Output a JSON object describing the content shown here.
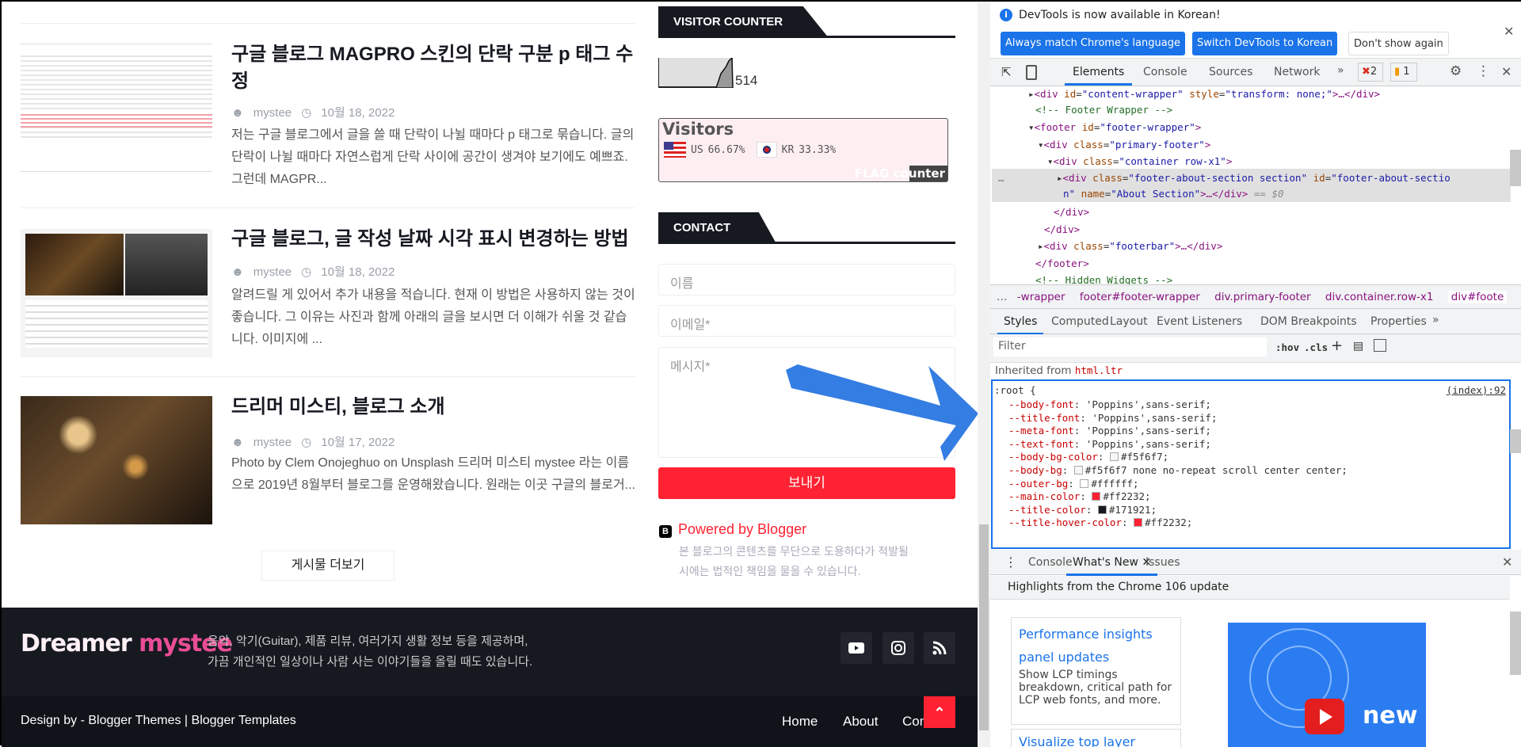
{
  "posts": [
    {
      "title": "구글 블로그 MAGPRO 스킨의 단락 구분 p 태그 수정",
      "author": "mystee",
      "date": "10월 18, 2022",
      "excerpt": "저는 구글 블로그에서 글을 쓸 때 단락이 나뉠 때마다 p 태그로 묶습니다. 글의 단락이 나뉠 때마다 자연스럽게 단락 사이에 공간이 생겨야 보기에도 예쁘죠. 그런데 MAGPR..."
    },
    {
      "title": "구글 블로그, 글 작성 날짜 시각 표시 변경하는 방법",
      "author": "mystee",
      "date": "10월 18, 2022",
      "excerpt": "알려드릴 게 있어서 추가 내용을 적습니다. 현재 이 방법은 사용하지 않는 것이 좋습니다. 그 이유는 사진과 함께 아래의 글을 보시면 더 이해가 쉬울 것 같습니다. 이미지에 ..."
    },
    {
      "title": "드리머 미스티, 블로그 소개",
      "author": "mystee",
      "date": "10월 17, 2022",
      "excerpt": "Photo by Clem Onojeghuo on Unsplash 드리머 미스티 mystee 라는 이름으로 2019년 8월부터 블로그를 운영해왔습니다. 원래는 이곳 구글의 블로거..."
    }
  ],
  "more_label": "게시물 더보기",
  "sidebar": {
    "visitor_title": "VISITOR COUNTER",
    "visitor_count": "514",
    "flag": {
      "title": "Visitors",
      "entries": [
        {
          "code": "US",
          "pct": "66.67%"
        },
        {
          "code": "KR",
          "pct": "33.33%"
        }
      ],
      "brand": "FLAG counter"
    },
    "contact_title": "CONTACT",
    "name_ph": "이름",
    "email_ph": "이메일*",
    "message_ph": "메시지*",
    "send": "보내기",
    "powered": "Powered by Blogger",
    "notice": "본 블로그의 콘텐츠를 무단으로 도용하다가 적발될 시에는 법적인 책임을 물을 수 있습니다."
  },
  "footer": {
    "logo": "Dreamer mystee",
    "about": "음악, 악기(Guitar), 제품 리뷰, 여러가지 생활 정보 등을 제공하며,\n가끔 개인적인 일상이나 사람 사는 이야기들을 올릴 때도 있습니다.",
    "credit": "Design by - Blogger Themes | Blogger Templates",
    "nav": [
      "Home",
      "About",
      "Con"
    ],
    "social": [
      "youtube",
      "instagram",
      "rss"
    ]
  },
  "colors": {
    "main": "#ff2232",
    "title": "#171921",
    "devtools_blue": "#1a73e8"
  },
  "devtools": {
    "notice": "DevTools is now available in Korean!",
    "btn_match": "Always match Chrome's language",
    "btn_switch": "Switch DevTools to Korean",
    "btn_dismiss": "Don't show again",
    "tabs": [
      "Elements",
      "Console",
      "Sources",
      "Network"
    ],
    "errors": "2",
    "warnings": "1",
    "breadcrumbs": [
      "-wrapper",
      "footer#footer-wrapper",
      "div.primary-footer",
      "div.container.row-x1",
      "div#foote"
    ],
    "style_tabs": [
      "Styles",
      "Computed",
      "Layout",
      "Event Listeners",
      "DOM Breakpoints",
      "Properties"
    ],
    "filter_ph": "Filter",
    "hov": ":hov",
    "cls": ".cls",
    "inherited": "Inherited from",
    "inherited_el": "html.ltr",
    "rule_selector": ":root {",
    "rule_source": "(index):92",
    "props": [
      {
        "name": "--body-font",
        "value": "'Poppins',sans-serif;"
      },
      {
        "name": "--title-font",
        "value": "'Poppins',sans-serif;"
      },
      {
        "name": "--meta-font",
        "value": "'Poppins',sans-serif;"
      },
      {
        "name": "--text-font",
        "value": "'Poppins',sans-serif;"
      },
      {
        "name": "--body-bg-color",
        "value": "#f5f6f7;",
        "swatch": "#f5f6f7"
      },
      {
        "name": "--body-bg",
        "value": "#f5f6f7 none no-repeat scroll center center;",
        "swatch": "#f5f6f7"
      },
      {
        "name": "--outer-bg",
        "value": "#ffffff;",
        "swatch": "#ffffff"
      },
      {
        "name": "--main-color",
        "value": "#ff2232;",
        "swatch": "#ff2232"
      },
      {
        "name": "--title-color",
        "value": "#171921;",
        "swatch": "#171921"
      },
      {
        "name": "--title-hover-color",
        "value": "#ff2232;",
        "swatch": "#ff2232"
      }
    ],
    "drawer_tabs": [
      "Console",
      "What's New",
      "Issues"
    ],
    "highlights": "Highlights from the Chrome 106 update",
    "card_title": "Performance insights panel updates",
    "card_text": "Show LCP timings breakdown, critical path for LCP web fonts, and more.",
    "card2_title": "Visualize top layer",
    "video_label": "new"
  }
}
